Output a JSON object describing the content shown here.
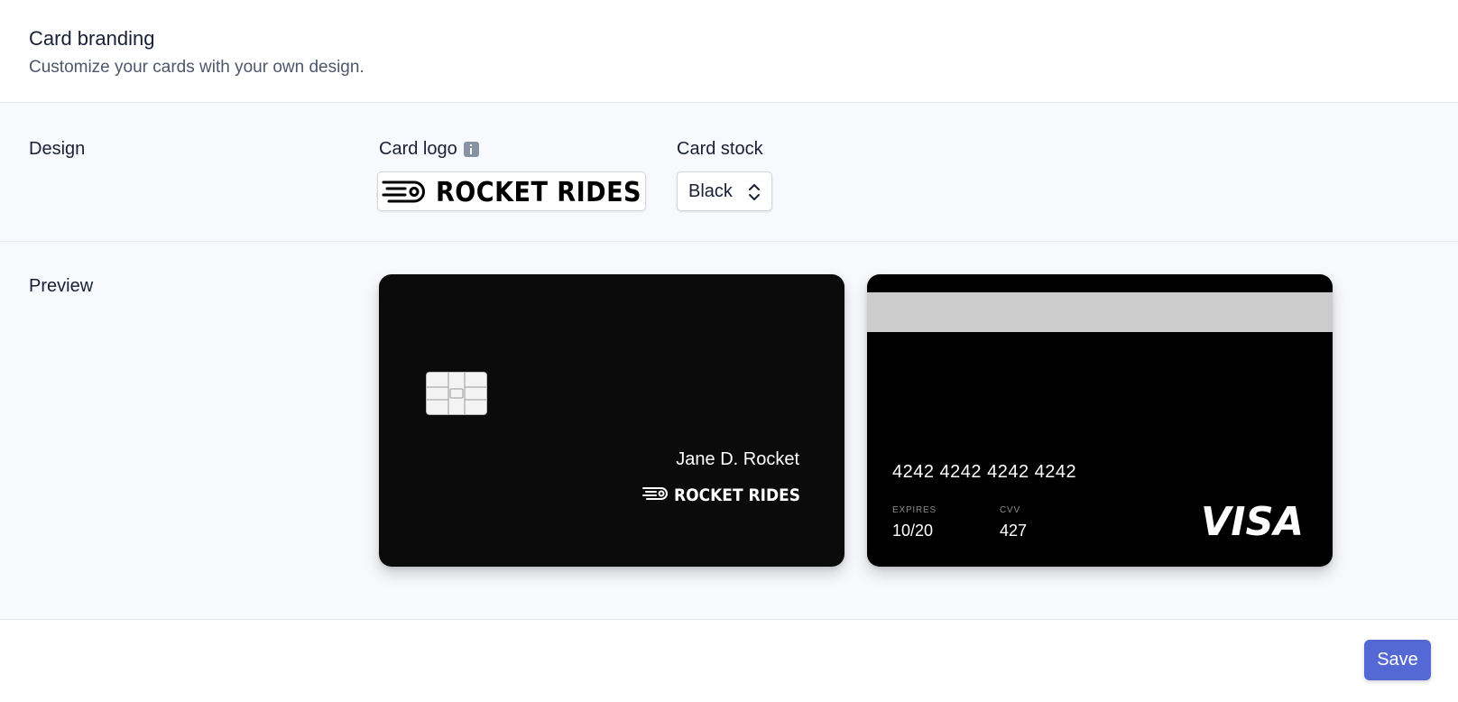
{
  "header": {
    "title": "Card branding",
    "subtitle": "Customize your cards with your own design."
  },
  "design": {
    "label": "Design",
    "card_logo_label": "Card logo",
    "card_logo_text": "ROCKET RIDES",
    "card_stock_label": "Card stock",
    "card_stock_value": "Black"
  },
  "preview": {
    "label": "Preview",
    "front": {
      "cardholder": "Jane D. Rocket",
      "logo_text": "ROCKET RIDES"
    },
    "back": {
      "card_number": "4242 4242 4242 4242",
      "expires_label": "EXPIRES",
      "expires_value": "10/20",
      "cvv_label": "CVV",
      "cvv_value": "427",
      "network": "VISA"
    }
  },
  "footer": {
    "save_label": "Save"
  },
  "colors": {
    "accent": "#5469d4",
    "section_bg": "#f7f9fc",
    "card_stock": "#0b0b0b"
  }
}
